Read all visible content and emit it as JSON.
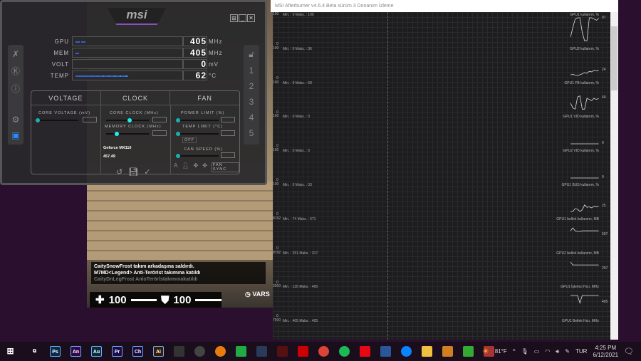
{
  "game": {
    "chat": [
      "CaitySnowFrost takım arkadaşına saldırdı.",
      "M7MD<Legend> Anti-Terörist takımına katıldı",
      "CaityDnLegFrost AnloTerörlstakımınakatıldı"
    ],
    "health": "100",
    "armor": "100",
    "vars": "VARS"
  },
  "afterburner": {
    "logo": "msi",
    "monitors": [
      {
        "label": "GPU",
        "value": "405",
        "unit": "MHz",
        "fill": 12
      },
      {
        "label": "MEM",
        "value": "405",
        "unit": "MHz",
        "fill": 4
      },
      {
        "label": "VOLT",
        "value": "0",
        "unit": "mV",
        "fill": 0
      },
      {
        "label": "TEMP",
        "value": "62",
        "unit": "°C",
        "fill": 62
      }
    ],
    "tabs": [
      "VOLTAGE",
      "CLOCK",
      "FAN"
    ],
    "labels": {
      "core_voltage": "CORE VOLTAGE (mV)",
      "core_clock": "CORE CLOCK (MHz)",
      "memory_clock": "MEMORY CLOCK (MHz)",
      "power_limit": "POWER LIMIT (%)",
      "temp_limit": "TEMP LIMIT (°C)",
      "fan_speed": "FAN SPEED (%)",
      "off": "OFF",
      "fan_sync": "FAN SYNC"
    },
    "gpu_name": "Geforce MX110",
    "driver": "457.49",
    "profiles": [
      "1",
      "2",
      "3",
      "4",
      "5"
    ]
  },
  "monitor": {
    "title": "MSI Afterburner v4.6.4 Beta sürüm 3 Donanım İzleme",
    "graphs": [
      {
        "top": "100",
        "minmax": "Min. : 0  Maks. : 100",
        "name": "GPU1 kullanım, %",
        "current": "97",
        "series": [
          20,
          60,
          95,
          100,
          100,
          40,
          5,
          5,
          100,
          100,
          95,
          90,
          97
        ]
      },
      {
        "top": "100",
        "minmax": "Min. : 0  Maks. : 36",
        "name": "GPU2 kullanım, %",
        "current": "24",
        "series": [
          5,
          8,
          4,
          3,
          6,
          10,
          15,
          12,
          20,
          18,
          24,
          22,
          24
        ]
      },
      {
        "top": "100",
        "minmax": "Min. : 0  Maks. : 68",
        "name": "GPU1 FB kullanım, %",
        "current": "49",
        "series": [
          30,
          10,
          5,
          55,
          60,
          5,
          5,
          50,
          45,
          40,
          50,
          45,
          49
        ]
      },
      {
        "top": "100",
        "minmax": "Min. : 0  Maks. : 0",
        "name": "GPU1 VID kullanım, %",
        "current": "0",
        "series": [
          0,
          0,
          0,
          0,
          0,
          0,
          0,
          0,
          0,
          0,
          0,
          0,
          0
        ]
      },
      {
        "top": "100",
        "minmax": "Min. : 0  Maks. : 0",
        "name": "GPU2 VID kullanım, %",
        "current": "0",
        "series": [
          0,
          0,
          0,
          0,
          0,
          0,
          0,
          0,
          0,
          0,
          0,
          0,
          0
        ]
      },
      {
        "top": "100",
        "minmax": "Min. : 0  Maks. : 33",
        "name": "GPU1 BUS kullanım, %",
        "current": "25",
        "series": [
          3,
          3,
          15,
          12,
          3,
          10,
          30,
          20,
          22,
          18,
          24,
          23,
          25
        ]
      },
      {
        "top": "8192",
        "minmax": "Min. : 74  Maks. : 671",
        "name": "GPU1 bellek kullanımı, MB",
        "current": "597",
        "series": [
          600,
          610,
          590,
          550,
          540,
          600,
          600,
          600,
          600,
          600,
          600,
          600,
          597
        ]
      },
      {
        "top": "8192",
        "minmax": "Min. : 251  Maks. : 317",
        "name": "GPU2 bellek kullanımı, MB",
        "current": "297",
        "series": [
          300,
          297,
          297,
          297,
          297,
          297,
          297,
          297,
          297,
          297,
          297,
          297,
          297
        ]
      },
      {
        "top": "2500",
        "minmax": "Min. : 135  Maks. : 405",
        "name": "GPU1 İşlemci Hızı, MHz",
        "current": "405",
        "series": [
          405,
          405,
          405,
          405,
          140,
          405,
          405,
          405,
          405,
          405,
          405,
          405,
          405
        ]
      },
      {
        "top": "7500",
        "minmax": "Min. : 405  Maks. : 405",
        "name": "GPU1 Bellek Hızı, MHz",
        "current": "",
        "series": []
      }
    ]
  },
  "taskbar": {
    "apps": [
      {
        "n": "Ps",
        "c": "#0b2a45"
      },
      {
        "n": "An",
        "c": "#33064a"
      },
      {
        "n": "Au",
        "c": "#0a2a3a"
      },
      {
        "n": "Pr",
        "c": "#1e0a45"
      },
      {
        "n": "Ch",
        "c": "#1a0a3a"
      },
      {
        "n": "Ai",
        "c": "#3a1a00"
      }
    ],
    "weather": "81°F",
    "lang": "TUR",
    "time": "4:25 PM",
    "date": "6/12/2021"
  }
}
